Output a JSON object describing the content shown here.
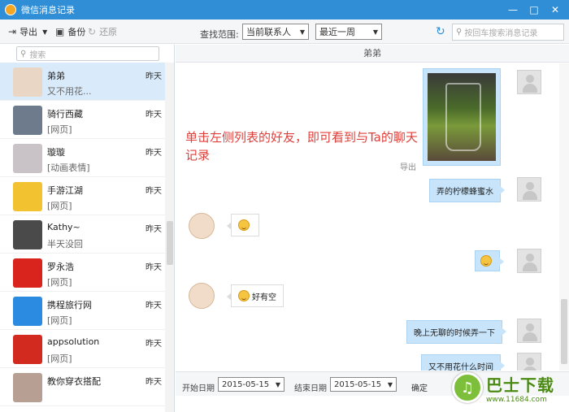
{
  "window": {
    "title": "微信消息记录"
  },
  "toolbar": {
    "export_label": "导出",
    "backup_label": "备份",
    "restore_label": "还原",
    "scope_label": "查找范围:",
    "scope_value": "当前联系人",
    "period_value": "最近一周",
    "search_placeholder": "按回车搜索消息记录"
  },
  "left": {
    "search_placeholder": "搜索",
    "contacts": [
      {
        "name": "弟弟",
        "time": "昨天",
        "preview": "又不用花...",
        "avatar_color": "#e9d6c4",
        "selected": true
      },
      {
        "name": "骑行西藏",
        "time": "昨天",
        "preview": "[网页]",
        "avatar_color": "#6d7b8c",
        "selected": false
      },
      {
        "name": "璇璇",
        "time": "昨天",
        "preview": "[动画表情]",
        "avatar_color": "#c9c2c7",
        "selected": false
      },
      {
        "name": "手游江湖",
        "time": "昨天",
        "preview": "[网页]",
        "avatar_color": "#f2c230",
        "selected": false
      },
      {
        "name": "Kathy~",
        "time": "昨天",
        "preview": "半天没回",
        "avatar_color": "#4a4a4a",
        "selected": false
      },
      {
        "name": "罗永浩",
        "time": "昨天",
        "preview": "[网页]",
        "avatar_color": "#d9231d",
        "selected": false
      },
      {
        "name": "携程旅行网",
        "time": "昨天",
        "preview": "[网页]",
        "avatar_color": "#2a8be0",
        "selected": false
      },
      {
        "name": "appsolution",
        "time": "昨天",
        "preview": "[网页]",
        "avatar_color": "#d32a1f",
        "selected": false
      },
      {
        "name": "教你穿衣搭配",
        "time": "昨天",
        "preview": "",
        "avatar_color": "#b7a093",
        "selected": false
      }
    ]
  },
  "chat": {
    "header": "弟弟",
    "hint": "单击左侧列表的好友，即可看到与Ta的聊天记录",
    "export_link": "导出",
    "messages": [
      {
        "from": "me",
        "type": "image"
      },
      {
        "from": "me",
        "text": "弄的柠檬蜂蜜水"
      },
      {
        "from": "other",
        "type": "emoji",
        "text": ""
      },
      {
        "from": "me",
        "type": "emoji",
        "text": ""
      },
      {
        "from": "other",
        "type": "emoji",
        "text": "好有空"
      },
      {
        "from": "me",
        "text": "晚上无聊的时候弄一下"
      },
      {
        "from": "me",
        "text": "又不用花什么时间"
      }
    ]
  },
  "bottom": {
    "start_label": "开始日期",
    "start_value": "2015-05-15",
    "end_label": "结束日期",
    "end_value": "2015-05-15",
    "confirm_label": "确定"
  },
  "watermark": {
    "big": "巴士下载",
    "small": "www.11684.com"
  }
}
